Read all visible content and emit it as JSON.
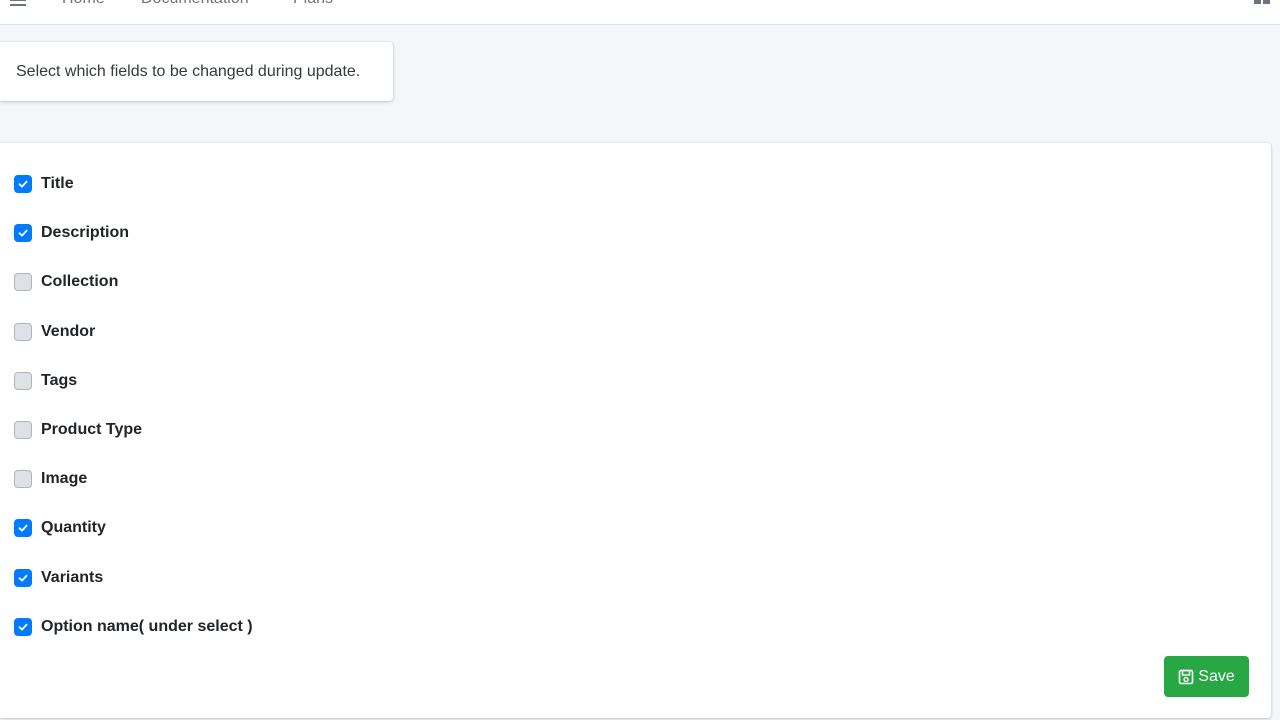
{
  "nav": {
    "items": [
      {
        "label": "Home"
      },
      {
        "label": "Documentation"
      },
      {
        "label": "Plans"
      }
    ]
  },
  "info": {
    "text": "Select which fields to be changed during update."
  },
  "fields": [
    {
      "label": "Title",
      "checked": true
    },
    {
      "label": "Description",
      "checked": true
    },
    {
      "label": "Collection",
      "checked": false
    },
    {
      "label": "Vendor",
      "checked": false
    },
    {
      "label": "Tags",
      "checked": false
    },
    {
      "label": "Product Type",
      "checked": false
    },
    {
      "label": "Image",
      "checked": false
    },
    {
      "label": "Quantity",
      "checked": true
    },
    {
      "label": "Variants",
      "checked": true
    },
    {
      "label": "Option name( under select )",
      "checked": true
    }
  ],
  "actions": {
    "save_label": "Save"
  },
  "colors": {
    "checked": "#007bff",
    "save_button": "#28a745",
    "background": "#f4f6f9"
  }
}
